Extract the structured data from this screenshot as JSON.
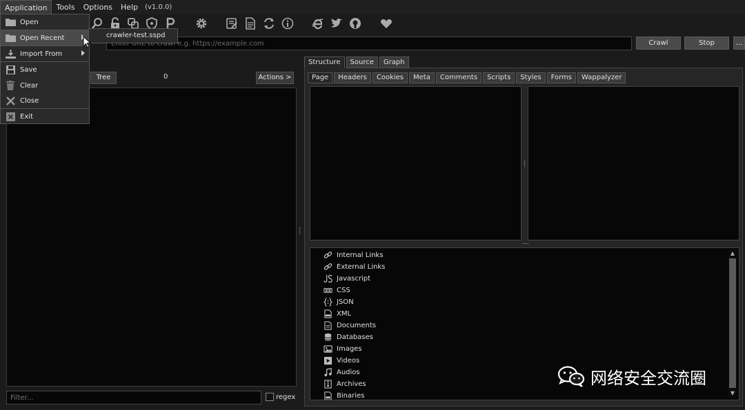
{
  "menubar": {
    "items": [
      "Application",
      "Tools",
      "Options",
      "Help"
    ],
    "version": "(v1.0.0)"
  },
  "app_menu": {
    "items": [
      {
        "label": "Open",
        "icon": "folder-icon"
      },
      {
        "label": "Open Recent",
        "icon": "folder-icon",
        "has_submenu": true
      },
      {
        "label": "Import From",
        "icon": "import-icon",
        "has_submenu": true
      },
      {
        "label": "Save",
        "icon": "save-icon"
      },
      {
        "label": "Clear",
        "icon": "trash-icon"
      },
      {
        "label": "Close",
        "icon": "close-icon"
      },
      {
        "label": "Exit",
        "icon": "exit-icon"
      }
    ],
    "recent_file": "crawler-test.sspd"
  },
  "url_bar": {
    "placeholder": "Enter URL to crawl e.g. https://example.com",
    "crawl_label": "Crawl",
    "stop_label": "Stop",
    "more_label": "..."
  },
  "left_panel": {
    "tree_label": "Tree",
    "count": "0",
    "actions_label": "Actions >",
    "filter_placeholder": "Filter...",
    "regex_label": "regex"
  },
  "right_panel": {
    "tabs": [
      "Structure",
      "Source",
      "Graph"
    ],
    "sub_tabs": [
      "Page",
      "Headers",
      "Cookies",
      "Meta",
      "Comments",
      "Scripts",
      "Styles",
      "Forms",
      "Wappalyzer"
    ],
    "tree_items": [
      {
        "label": "Internal Links",
        "icon": "link-icon"
      },
      {
        "label": "External Links",
        "icon": "link-icon"
      },
      {
        "label": "Javascript",
        "icon": "js-icon"
      },
      {
        "label": "CSS",
        "icon": "css-icon"
      },
      {
        "label": "JSON",
        "icon": "json-icon"
      },
      {
        "label": "XML",
        "icon": "xml-icon"
      },
      {
        "label": "Documents",
        "icon": "document-icon"
      },
      {
        "label": "Databases",
        "icon": "database-icon"
      },
      {
        "label": "Images",
        "icon": "image-icon"
      },
      {
        "label": "Videos",
        "icon": "video-icon"
      },
      {
        "label": "Audios",
        "icon": "music-icon"
      },
      {
        "label": "Archives",
        "icon": "archive-icon"
      },
      {
        "label": "Binaries",
        "icon": "binary-icon"
      }
    ]
  },
  "watermark": {
    "text": "网络安全交流圈"
  },
  "colors": {
    "background": "#1b1b1b",
    "pane": "#070707",
    "button": "#4a4a4a",
    "text": "#e0e0e0"
  }
}
